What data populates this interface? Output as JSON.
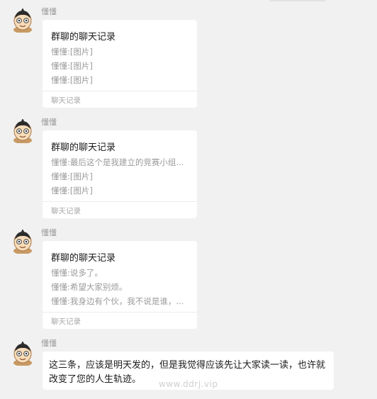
{
  "messages": [
    {
      "sender": "懂懂",
      "card": {
        "title": "群聊的聊天记录",
        "lines": [
          "懂懂:[图片]",
          "懂懂:[图片]",
          "懂懂:[图片]"
        ],
        "footer": "聊天记录"
      }
    },
    {
      "sender": "懂懂",
      "card": {
        "title": "群聊的聊天记录",
        "lines": [
          "懂懂:最后这个是我建立的竞赛小组...",
          "懂懂:[图片]",
          "懂懂:[图片]"
        ],
        "footer": "聊天记录"
      }
    },
    {
      "sender": "懂懂",
      "card": {
        "title": "群聊的聊天记录",
        "lines": [
          "懂懂:说多了。",
          "懂懂:希望大家别烦。",
          "懂懂:我身边有个伙，我不说是谁，..."
        ],
        "footer": "聊天记录"
      }
    },
    {
      "sender": "懂懂",
      "text": "这三条，应该是明天发的，但是我觉得应该先让大家读一读，也许就改变了您的人生轨迹。"
    }
  ],
  "watermark": "www.ddrj.vip",
  "icons": {
    "avatar": "cartoon-boy-avatar-icon"
  }
}
